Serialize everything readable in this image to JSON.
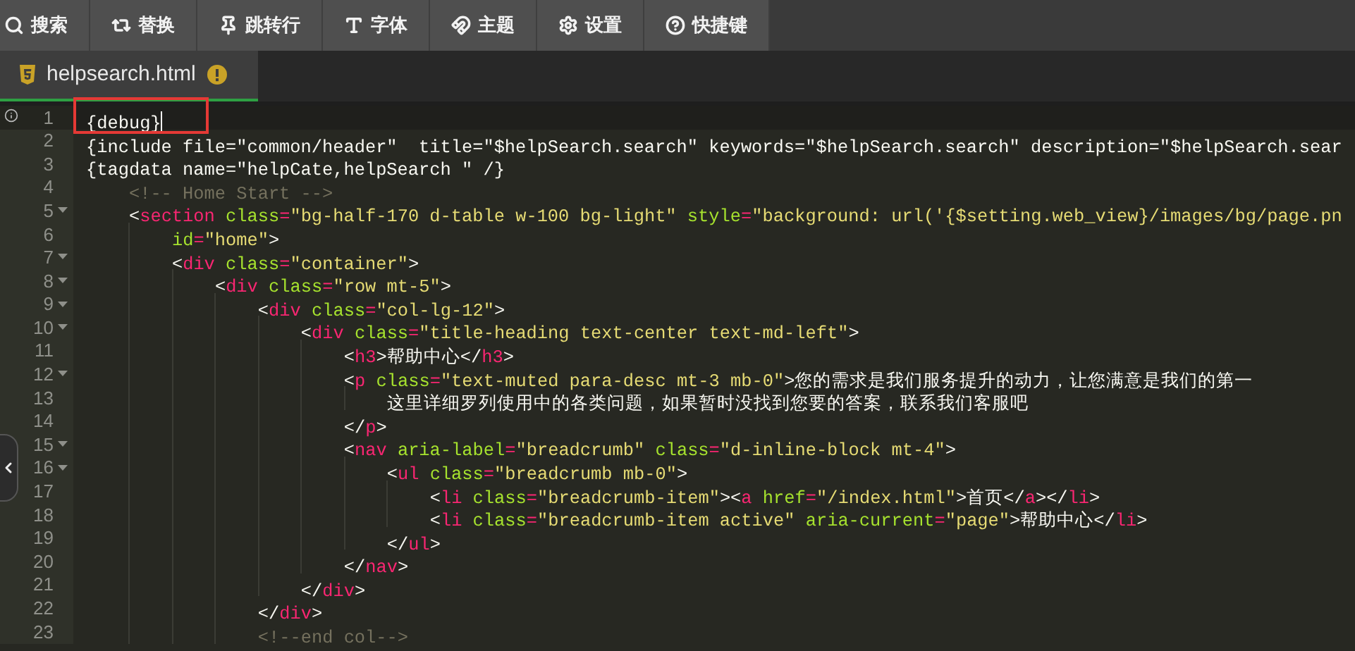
{
  "toolbar": [
    {
      "label": "搜索"
    },
    {
      "label": "替换"
    },
    {
      "label": "跳转行"
    },
    {
      "label": "字体"
    },
    {
      "label": "主题"
    },
    {
      "label": "设置"
    },
    {
      "label": "快捷键"
    }
  ],
  "tabs": [
    {
      "label": "helpsearch.html",
      "selected": true,
      "modified": true
    }
  ],
  "lines": [
    {
      "number": "1",
      "foldable": false,
      "active": true,
      "highlighted": true,
      "tokens": [
        {
          "kind": "plain",
          "text": "{debug}"
        }
      ]
    },
    {
      "number": "2",
      "foldable": false,
      "active": false,
      "highlighted": false,
      "tokens": [
        {
          "kind": "plain",
          "text": "{include file=\"common/header\"  title=\"$helpSearch.search\" keywords=\"$helpSearch.search\" description=\"$helpSearch.sear"
        }
      ]
    },
    {
      "number": "3",
      "foldable": false,
      "active": false,
      "highlighted": false,
      "tokens": [
        {
          "kind": "plain",
          "text": "{tagdata name=\"helpCate,helpSearch \" /}"
        }
      ]
    },
    {
      "number": "4",
      "foldable": false,
      "active": false,
      "highlighted": false,
      "tokens": [
        {
          "kind": "comment",
          "text": "    <!-- Home Start -->"
        }
      ]
    },
    {
      "number": "5",
      "foldable": true,
      "active": false,
      "highlighted": false,
      "tokens": [
        {
          "kind": "plain",
          "text": "    <"
        },
        {
          "kind": "tag",
          "text": "section"
        },
        {
          "kind": "attr",
          "text": " class"
        },
        {
          "kind": "eq",
          "text": "="
        },
        {
          "kind": "string",
          "text": "\"bg-half-170 d-table w-100 bg-light\""
        },
        {
          "kind": "attr",
          "text": " style"
        },
        {
          "kind": "eq",
          "text": "="
        },
        {
          "kind": "string",
          "text": "\"background: url('{$setting.web_view}/images/bg/page.pn"
        }
      ]
    },
    {
      "number": "6",
      "foldable": false,
      "active": false,
      "highlighted": false,
      "tokens": [
        {
          "kind": "attr",
          "text": "        id"
        },
        {
          "kind": "eq",
          "text": "="
        },
        {
          "kind": "string",
          "text": "\"home\""
        },
        {
          "kind": "plain",
          "text": ">"
        }
      ]
    },
    {
      "number": "7",
      "foldable": true,
      "active": false,
      "highlighted": false,
      "tokens": [
        {
          "kind": "plain",
          "text": "        <"
        },
        {
          "kind": "tag",
          "text": "div"
        },
        {
          "kind": "attr",
          "text": " class"
        },
        {
          "kind": "eq",
          "text": "="
        },
        {
          "kind": "string",
          "text": "\"container\""
        },
        {
          "kind": "plain",
          "text": ">"
        }
      ]
    },
    {
      "number": "8",
      "foldable": true,
      "active": false,
      "highlighted": false,
      "tokens": [
        {
          "kind": "plain",
          "text": "            <"
        },
        {
          "kind": "tag",
          "text": "div"
        },
        {
          "kind": "attr",
          "text": " class"
        },
        {
          "kind": "eq",
          "text": "="
        },
        {
          "kind": "string",
          "text": "\"row mt-5\""
        },
        {
          "kind": "plain",
          "text": ">"
        }
      ]
    },
    {
      "number": "9",
      "foldable": true,
      "active": false,
      "highlighted": false,
      "tokens": [
        {
          "kind": "plain",
          "text": "                <"
        },
        {
          "kind": "tag",
          "text": "div"
        },
        {
          "kind": "attr",
          "text": " class"
        },
        {
          "kind": "eq",
          "text": "="
        },
        {
          "kind": "string",
          "text": "\"col-lg-12\""
        },
        {
          "kind": "plain",
          "text": ">"
        }
      ]
    },
    {
      "number": "10",
      "foldable": true,
      "active": false,
      "highlighted": false,
      "tokens": [
        {
          "kind": "plain",
          "text": "                    <"
        },
        {
          "kind": "tag",
          "text": "div"
        },
        {
          "kind": "attr",
          "text": " class"
        },
        {
          "kind": "eq",
          "text": "="
        },
        {
          "kind": "string",
          "text": "\"title-heading text-center text-md-left\""
        },
        {
          "kind": "plain",
          "text": ">"
        }
      ]
    },
    {
      "number": "11",
      "foldable": false,
      "active": false,
      "highlighted": false,
      "tokens": [
        {
          "kind": "plain",
          "text": "                        <"
        },
        {
          "kind": "tag",
          "text": "h3"
        },
        {
          "kind": "plain",
          "text": ">帮助中心</"
        },
        {
          "kind": "tag",
          "text": "h3"
        },
        {
          "kind": "plain",
          "text": ">"
        }
      ]
    },
    {
      "number": "12",
      "foldable": true,
      "active": false,
      "highlighted": false,
      "tokens": [
        {
          "kind": "plain",
          "text": "                        <"
        },
        {
          "kind": "tag",
          "text": "p"
        },
        {
          "kind": "attr",
          "text": " class"
        },
        {
          "kind": "eq",
          "text": "="
        },
        {
          "kind": "string",
          "text": "\"text-muted para-desc mt-3 mb-0\""
        },
        {
          "kind": "plain",
          "text": ">您的需求是我们服务提升的动力，让您满意是我们的第一"
        }
      ]
    },
    {
      "number": "13",
      "foldable": false,
      "active": false,
      "highlighted": false,
      "tokens": [
        {
          "kind": "plain",
          "text": "                            这里详细罗列使用中的各类问题，如果暂时没找到您要的答案，联系我们客服吧"
        }
      ]
    },
    {
      "number": "14",
      "foldable": false,
      "active": false,
      "highlighted": false,
      "tokens": [
        {
          "kind": "plain",
          "text": "                        </"
        },
        {
          "kind": "tag",
          "text": "p"
        },
        {
          "kind": "plain",
          "text": ">"
        }
      ]
    },
    {
      "number": "15",
      "foldable": true,
      "active": false,
      "highlighted": false,
      "tokens": [
        {
          "kind": "plain",
          "text": "                        <"
        },
        {
          "kind": "tag",
          "text": "nav"
        },
        {
          "kind": "attr",
          "text": " aria-label"
        },
        {
          "kind": "eq",
          "text": "="
        },
        {
          "kind": "string",
          "text": "\"breadcrumb\""
        },
        {
          "kind": "attr",
          "text": " class"
        },
        {
          "kind": "eq",
          "text": "="
        },
        {
          "kind": "string",
          "text": "\"d-inline-block mt-4\""
        },
        {
          "kind": "plain",
          "text": ">"
        }
      ]
    },
    {
      "number": "16",
      "foldable": true,
      "active": false,
      "highlighted": false,
      "tokens": [
        {
          "kind": "plain",
          "text": "                            <"
        },
        {
          "kind": "tag",
          "text": "ul"
        },
        {
          "kind": "attr",
          "text": " class"
        },
        {
          "kind": "eq",
          "text": "="
        },
        {
          "kind": "string",
          "text": "\"breadcrumb mb-0\""
        },
        {
          "kind": "plain",
          "text": ">"
        }
      ]
    },
    {
      "number": "17",
      "foldable": false,
      "active": false,
      "highlighted": false,
      "tokens": [
        {
          "kind": "plain",
          "text": "                                <"
        },
        {
          "kind": "tag",
          "text": "li"
        },
        {
          "kind": "attr",
          "text": " class"
        },
        {
          "kind": "eq",
          "text": "="
        },
        {
          "kind": "string",
          "text": "\"breadcrumb-item\""
        },
        {
          "kind": "plain",
          "text": "><"
        },
        {
          "kind": "tag",
          "text": "a"
        },
        {
          "kind": "attr",
          "text": " href"
        },
        {
          "kind": "eq",
          "text": "="
        },
        {
          "kind": "string",
          "text": "\"/index.html\""
        },
        {
          "kind": "plain",
          "text": ">首页</"
        },
        {
          "kind": "tag",
          "text": "a"
        },
        {
          "kind": "plain",
          "text": "></"
        },
        {
          "kind": "tag",
          "text": "li"
        },
        {
          "kind": "plain",
          "text": ">"
        }
      ]
    },
    {
      "number": "18",
      "foldable": false,
      "active": false,
      "highlighted": false,
      "tokens": [
        {
          "kind": "plain",
          "text": "                                <"
        },
        {
          "kind": "tag",
          "text": "li"
        },
        {
          "kind": "attr",
          "text": " class"
        },
        {
          "kind": "eq",
          "text": "="
        },
        {
          "kind": "string",
          "text": "\"breadcrumb-item active\""
        },
        {
          "kind": "attr",
          "text": " aria-current"
        },
        {
          "kind": "eq",
          "text": "="
        },
        {
          "kind": "string",
          "text": "\"page\""
        },
        {
          "kind": "plain",
          "text": ">帮助中心</"
        },
        {
          "kind": "tag",
          "text": "li"
        },
        {
          "kind": "plain",
          "text": ">"
        }
      ]
    },
    {
      "number": "19",
      "foldable": false,
      "active": false,
      "highlighted": false,
      "tokens": [
        {
          "kind": "plain",
          "text": "                            </"
        },
        {
          "kind": "tag",
          "text": "ul"
        },
        {
          "kind": "plain",
          "text": ">"
        }
      ]
    },
    {
      "number": "20",
      "foldable": false,
      "active": false,
      "highlighted": false,
      "tokens": [
        {
          "kind": "plain",
          "text": "                        </"
        },
        {
          "kind": "tag",
          "text": "nav"
        },
        {
          "kind": "plain",
          "text": ">"
        }
      ]
    },
    {
      "number": "21",
      "foldable": false,
      "active": false,
      "highlighted": false,
      "tokens": [
        {
          "kind": "plain",
          "text": "                    </"
        },
        {
          "kind": "tag",
          "text": "div"
        },
        {
          "kind": "plain",
          "text": ">"
        }
      ]
    },
    {
      "number": "22",
      "foldable": false,
      "active": false,
      "highlighted": false,
      "tokens": [
        {
          "kind": "plain",
          "text": "                </"
        },
        {
          "kind": "tag",
          "text": "div"
        },
        {
          "kind": "plain",
          "text": ">"
        }
      ]
    },
    {
      "number": "23",
      "foldable": false,
      "active": false,
      "highlighted": false,
      "tokens": [
        {
          "kind": "comment",
          "text": "                <!--end col-->"
        }
      ]
    }
  ]
}
